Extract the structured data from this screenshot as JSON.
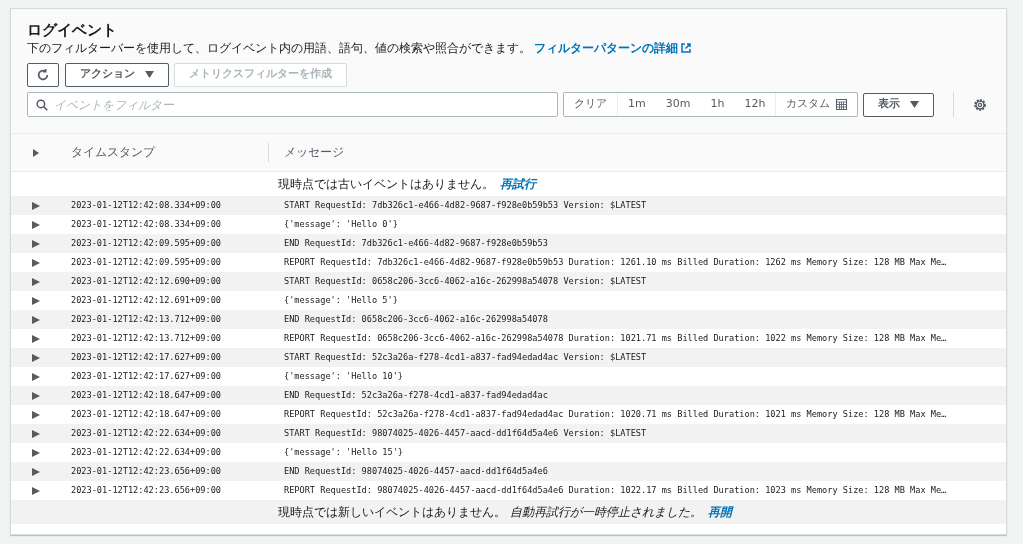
{
  "header": {
    "title": "ログイベント",
    "description": "下のフィルターバーを使用して、ログイベント内の用語、語句、値の検索や照合ができます。",
    "help_link": "フィルターパターンの詳細"
  },
  "actions": {
    "action_menu": "アクション",
    "create_metric_filter": {
      "label": "メトリクスフィルターを作成",
      "disabled": true
    }
  },
  "filter": {
    "placeholder": "イベントをフィルター",
    "clear": "クリア",
    "ranges": [
      "1m",
      "30m",
      "1h",
      "12h"
    ],
    "custom": "カスタム",
    "display_menu": "表示"
  },
  "table": {
    "columns": [
      "タイムスタンプ",
      "メッセージ"
    ],
    "top_notice": {
      "text": "現時点では古いイベントはありません。",
      "link": "再試行"
    },
    "rows": [
      {
        "timestamp": "2023-01-12T12:42:08.334+09:00",
        "message": "START RequestId: 7db326c1-e466-4d82-9687-f928e0b59b53 Version: $LATEST",
        "expanded": false
      },
      {
        "timestamp": "2023-01-12T12:42:08.334+09:00",
        "message": "{'message': 'Hello 0'}",
        "expanded": false
      },
      {
        "timestamp": "2023-01-12T12:42:09.595+09:00",
        "message": "END RequestId: 7db326c1-e466-4d82-9687-f928e0b59b53",
        "expanded": false
      },
      {
        "timestamp": "2023-01-12T12:42:09.595+09:00",
        "message": "REPORT RequestId: 7db326c1-e466-4d82-9687-f928e0b59b53 Duration: 1261.10 ms Billed Duration: 1262 ms Memory Size: 128 MB Max Me…",
        "expanded": false
      },
      {
        "timestamp": "2023-01-12T12:42:12.690+09:00",
        "message": "START RequestId: 0658c206-3cc6-4062-a16c-262998a54078 Version: $LATEST",
        "expanded": false
      },
      {
        "timestamp": "2023-01-12T12:42:12.691+09:00",
        "message": "{'message': 'Hello 5'}",
        "expanded": false
      },
      {
        "timestamp": "2023-01-12T12:42:13.712+09:00",
        "message": "END RequestId: 0658c206-3cc6-4062-a16c-262998a54078",
        "expanded": false
      },
      {
        "timestamp": "2023-01-12T12:42:13.712+09:00",
        "message": "REPORT RequestId: 0658c206-3cc6-4062-a16c-262998a54078 Duration: 1021.71 ms Billed Duration: 1022 ms Memory Size: 128 MB Max Me…",
        "expanded": false
      },
      {
        "timestamp": "2023-01-12T12:42:17.627+09:00",
        "message": "START RequestId: 52c3a26a-f278-4cd1-a837-fad94edad4ac Version: $LATEST",
        "expanded": false
      },
      {
        "timestamp": "2023-01-12T12:42:17.627+09:00",
        "message": "{'message': 'Hello 10'}",
        "expanded": false
      },
      {
        "timestamp": "2023-01-12T12:42:18.647+09:00",
        "message": "END RequestId: 52c3a26a-f278-4cd1-a837-fad94edad4ac",
        "expanded": false
      },
      {
        "timestamp": "2023-01-12T12:42:18.647+09:00",
        "message": "REPORT RequestId: 52c3a26a-f278-4cd1-a837-fad94edad4ac Duration: 1020.71 ms Billed Duration: 1021 ms Memory Size: 128 MB Max Me…",
        "expanded": false
      },
      {
        "timestamp": "2023-01-12T12:42:22.634+09:00",
        "message": "START RequestId: 98074025-4026-4457-aacd-dd1f64d5a4e6 Version: $LATEST",
        "expanded": false
      },
      {
        "timestamp": "2023-01-12T12:42:22.634+09:00",
        "message": "{'message': 'Hello 15'}",
        "expanded": false
      },
      {
        "timestamp": "2023-01-12T12:42:23.656+09:00",
        "message": "END RequestId: 98074025-4026-4457-aacd-dd1f64d5a4e6",
        "expanded": false
      },
      {
        "timestamp": "2023-01-12T12:42:23.656+09:00",
        "message": "REPORT RequestId: 98074025-4026-4457-aacd-dd1f64d5a4e6 Duration: 1022.17 ms Billed Duration: 1023 ms Memory Size: 128 MB Max Me…",
        "expanded": false
      }
    ],
    "bottom_notice": {
      "text": "現時点では新しいイベントはありません。 *自動再試行が一時停止されました。*",
      "link": "再開"
    }
  }
}
